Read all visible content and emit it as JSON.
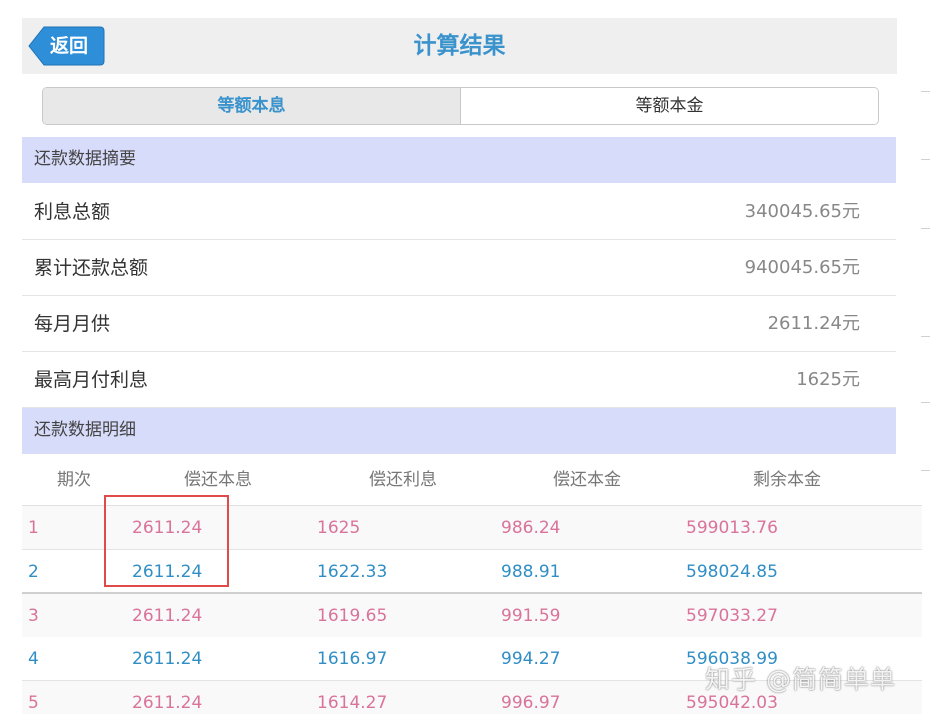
{
  "header": {
    "back_label": "返回",
    "title": "计算结果"
  },
  "tabs": [
    {
      "label": "等额本息",
      "active": true
    },
    {
      "label": "等额本金",
      "active": false
    }
  ],
  "summary": {
    "section_title": "还款数据摘要",
    "rows": [
      {
        "label": "利息总额",
        "value": "340045.65元"
      },
      {
        "label": "累计还款总额",
        "value": "940045.65元"
      },
      {
        "label": "每月月供",
        "value": "2611.24元"
      },
      {
        "label": "最高月付利息",
        "value": "1625元"
      }
    ]
  },
  "detail": {
    "section_title": "还款数据明细",
    "columns": [
      "期次",
      "偿还本息",
      "偿还利息",
      "偿还本金",
      "剩余本金"
    ],
    "rows": [
      [
        "1",
        "2611.24",
        "1625",
        "986.24",
        "599013.76"
      ],
      [
        "2",
        "2611.24",
        "1622.33",
        "988.91",
        "598024.85"
      ],
      [
        "3",
        "2611.24",
        "1619.65",
        "991.59",
        "597033.27"
      ],
      [
        "4",
        "2611.24",
        "1616.97",
        "994.27",
        "596038.99"
      ],
      [
        "5",
        "2611.24",
        "1614.27",
        "996.97",
        "595042.03"
      ]
    ]
  },
  "watermark": "知乎 @简简单单",
  "colors": {
    "accent_blue": "#3a93cc",
    "back_button": "#2e8fd8",
    "section_bg": "#d8dcfb",
    "odd_row_text": "#d9739a",
    "even_row_text": "#2f8ec5",
    "highlight": "#e04a4a"
  }
}
